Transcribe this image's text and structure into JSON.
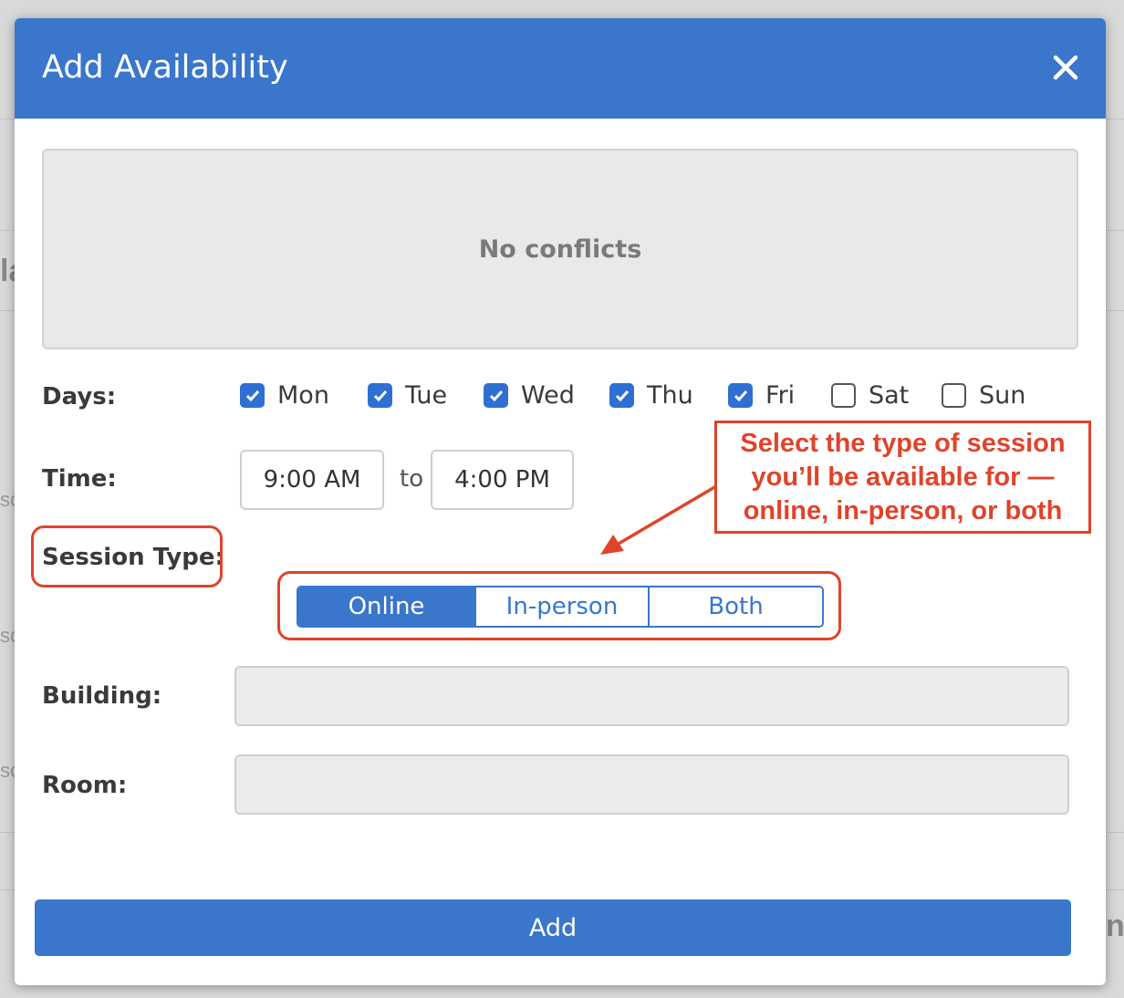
{
  "background_fragments": [
    "la",
    "sc",
    "sc",
    "sc",
    "n"
  ],
  "modal": {
    "title": "Add Availability",
    "close_icon": "close-icon",
    "conflicts_text": "No conflicts",
    "days_label": "Days:",
    "days": [
      {
        "label": "Mon",
        "checked": true
      },
      {
        "label": "Tue",
        "checked": true
      },
      {
        "label": "Wed",
        "checked": true
      },
      {
        "label": "Thu",
        "checked": true
      },
      {
        "label": "Fri",
        "checked": true
      },
      {
        "label": "Sat",
        "checked": false
      },
      {
        "label": "Sun",
        "checked": false
      }
    ],
    "time_label": "Time:",
    "time_start": "9:00 AM",
    "time_separator": "to",
    "time_end": "4:00 PM",
    "session_type_label": "Session Type:",
    "session_options": [
      "Online",
      "In-person",
      "Both"
    ],
    "session_selected": "Online",
    "building_label": "Building:",
    "building_value": "",
    "room_label": "Room:",
    "room_value": "",
    "add_label": "Add"
  },
  "annotation": {
    "lines": [
      "Select the type of session",
      "you’ll be available for —",
      "online, in-person, or both"
    ],
    "color": "#e0432b"
  },
  "colors": {
    "header": "#3976cc",
    "checkbox": "#2f6fd1",
    "annotation": "#e0432b"
  }
}
